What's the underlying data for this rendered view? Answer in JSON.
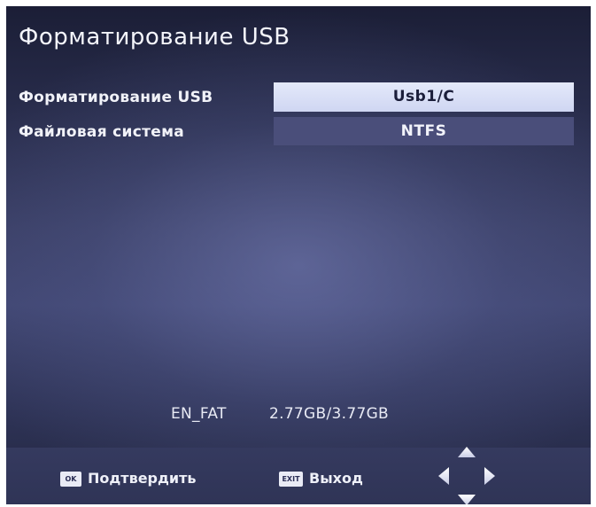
{
  "screen": {
    "title": "Форматирование USB"
  },
  "settings": [
    {
      "label": "Форматирование USB",
      "value": "Usb1/C",
      "selected": true
    },
    {
      "label": "Файловая система",
      "value": "NTFS",
      "selected": false
    }
  ],
  "status": {
    "name": "EN_FAT",
    "size": "2.77GB/3.77GB"
  },
  "footer": {
    "ok_key": "OK",
    "ok_label": "Подтвердить",
    "exit_key": "EXIT",
    "exit_label": "Выход",
    "nav_icon": "dpad-navigation-icon"
  },
  "colors": {
    "selected_bg": "#d8def6",
    "unselected_bg": "#4a4e7a",
    "screen_bg": "#2e3356"
  }
}
